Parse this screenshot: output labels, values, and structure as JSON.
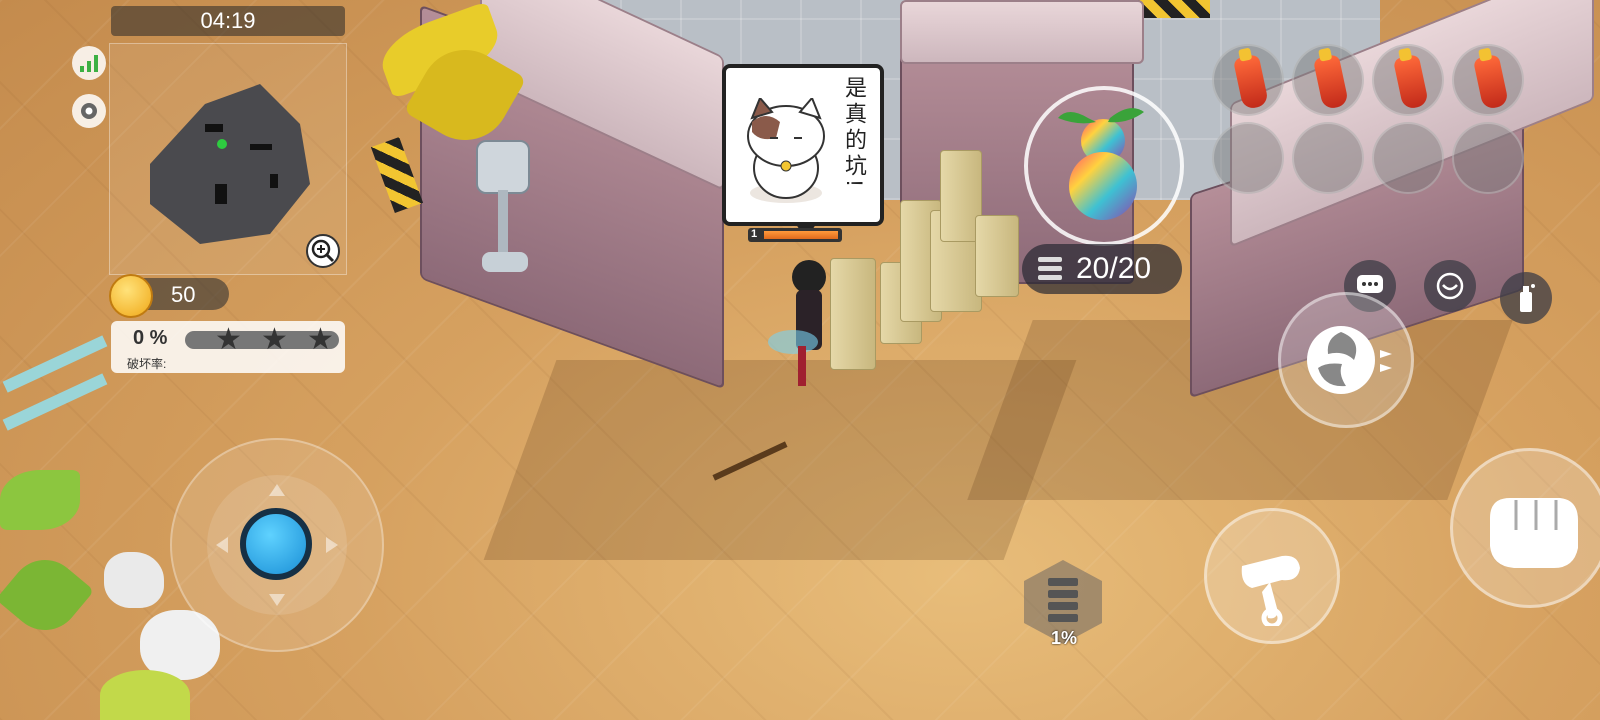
{
  "hud": {
    "timer": "04:19",
    "coins": "50",
    "destruction": {
      "percent_label": "0 %",
      "label": "破坏率:",
      "value": 0,
      "stars": 3
    }
  },
  "speech_bubble": {
    "text": "是真的坑!"
  },
  "player": {
    "level": "1"
  },
  "weapon": {
    "ammo": "20/20"
  },
  "item_slots": {
    "filled": 4,
    "total": 8
  },
  "energy": {
    "percent_label": "1%",
    "value": 1
  },
  "colors": {
    "joystick": "#1a8fd6",
    "coin": "#f0a818",
    "hp": "#e06a1c"
  },
  "icons": {
    "signal": "signal-bars-icon",
    "settings": "gear-icon",
    "zoom": "zoom-in-icon",
    "chat": "chat-icon",
    "emote": "emote-face-icon",
    "spray": "spray-can-icon",
    "dash": "dash-swirl-icon",
    "repair": "wrench-hand-icon",
    "attack": "fist-icon"
  }
}
